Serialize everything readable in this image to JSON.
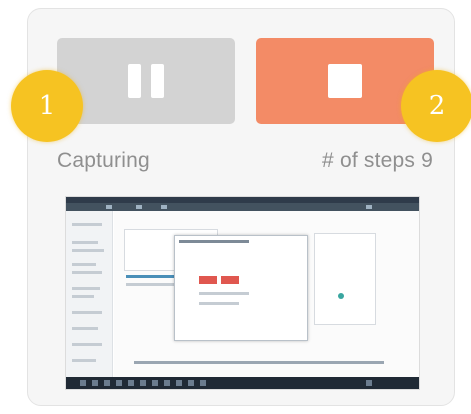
{
  "controls": {
    "pause_button": {
      "icon": "pause-icon",
      "state": "active",
      "color": "#d3d3d3"
    },
    "stop_button": {
      "icon": "stop-icon",
      "color": "#f38b66"
    }
  },
  "callouts": {
    "badge_1": "1",
    "badge_2": "2",
    "color": "#f6c322"
  },
  "status": {
    "left_label": "Capturing",
    "right_label": "# of steps 9"
  },
  "preview": {
    "kind": "screenshot-thumbnail",
    "accent_colors": [
      "#2f3b4a",
      "#e0574f",
      "#39a6a0"
    ]
  }
}
